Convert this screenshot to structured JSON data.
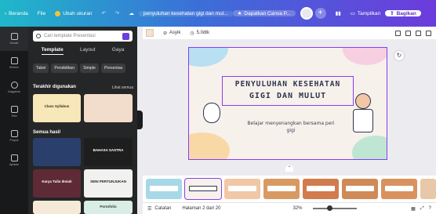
{
  "topbar": {
    "home": "Beranda",
    "file": "File",
    "resize": "Ubah ukuran",
    "doc_title": "penyuluhan kesehatan gigi dan mul...",
    "get_pro": "Dapatkan Canva P...",
    "present": "Tampilkan",
    "share": "Bagikan"
  },
  "rail": {
    "items": [
      {
        "label": "Desain",
        "icon": "layout-icon"
      },
      {
        "label": "Elemen",
        "icon": "shapes-icon"
      },
      {
        "label": "Unggahan",
        "icon": "upload-icon"
      },
      {
        "label": "Teks",
        "icon": "text-icon"
      },
      {
        "label": "Proyek",
        "icon": "folder-icon"
      },
      {
        "label": "Aplikasi",
        "icon": "apps-icon"
      }
    ]
  },
  "panel": {
    "search_placeholder": "Cari template Presentasi",
    "tabs": [
      "Template",
      "Layout",
      "Gaya"
    ],
    "chips": [
      "Tabel",
      "Pendidikan",
      "Simple",
      "Presentas"
    ],
    "recent_title": "Terakhir digunakan",
    "see_all": "Lihat semua",
    "all_title": "Semua hasil",
    "thumbs": [
      {
        "text": "Class Syllabus",
        "bg": "#f7e7b9",
        "fg": "#3a2f1f"
      },
      {
        "text": "",
        "bg": "#f2dccb",
        "fg": "#3a2f1f"
      },
      {
        "text": "",
        "bg": "#2a3f6b",
        "fg": "#ffffff"
      },
      {
        "text": "BAHASA SASTRA",
        "bg": "#1e1e1e",
        "fg": "#ffffff"
      },
      {
        "text": "Karya Tulis Ilmiah",
        "bg": "#5e2a36",
        "fg": "#ffffff"
      },
      {
        "text": "SENI PERTUNJUKAN",
        "bg": "#f1f1ef",
        "fg": "#222222"
      },
      {
        "text": "",
        "bg": "#f4ead7",
        "fg": "#3a2f1f"
      },
      {
        "text": "Portofolio",
        "bg": "#d8ede4",
        "fg": "#2f3a35"
      }
    ]
  },
  "toolbar": {
    "animate": "Asyik",
    "duration": "5.0dtk"
  },
  "slide": {
    "title_line1": "PENYULUHAN KESEHATAN",
    "title_line2": "GIGI DAN MULUT",
    "subtitle": "Belajar menyenangkan bersama peri gigi"
  },
  "bottom": {
    "notes": "Catatan",
    "page": "Halaman 2 dari 20",
    "zoom": "32%",
    "zoom_fraction": 0.32
  },
  "colors": {
    "accent": "#8b3cf0",
    "slide_bg": "#f6f1ea"
  }
}
